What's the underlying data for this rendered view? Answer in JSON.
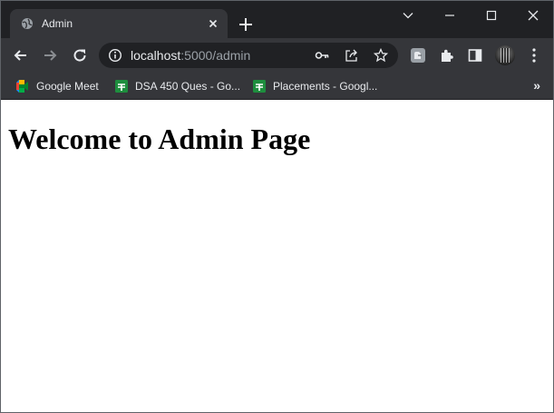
{
  "tab": {
    "title": "Admin",
    "favicon": "globe-icon"
  },
  "window_controls": [
    "chevron-down-icon",
    "minimize-icon",
    "maximize-icon",
    "close-icon"
  ],
  "toolbar": {
    "url_host": "localhost",
    "url_rest": ":5000/admin",
    "icons": [
      "back-icon",
      "forward-icon",
      "reload-icon",
      "info-icon",
      "key-icon",
      "share-icon",
      "star-icon",
      "extension-icon",
      "puzzle-icon",
      "side-panel-icon"
    ]
  },
  "bookmarks": [
    {
      "label": "Google Meet",
      "icon": "google-meet-icon"
    },
    {
      "label": "DSA 450 Ques - Go...",
      "icon": "google-sheets-icon"
    },
    {
      "label": "Placements - Googl...",
      "icon": "google-sheets-icon"
    }
  ],
  "bookmarks_more": "»",
  "page": {
    "heading": "Welcome to Admin Page"
  },
  "colors": {
    "titlebar": "#202124",
    "toolbar": "#35363a",
    "text": "#e8eaed",
    "sheets_green": "#1e8e3e"
  }
}
